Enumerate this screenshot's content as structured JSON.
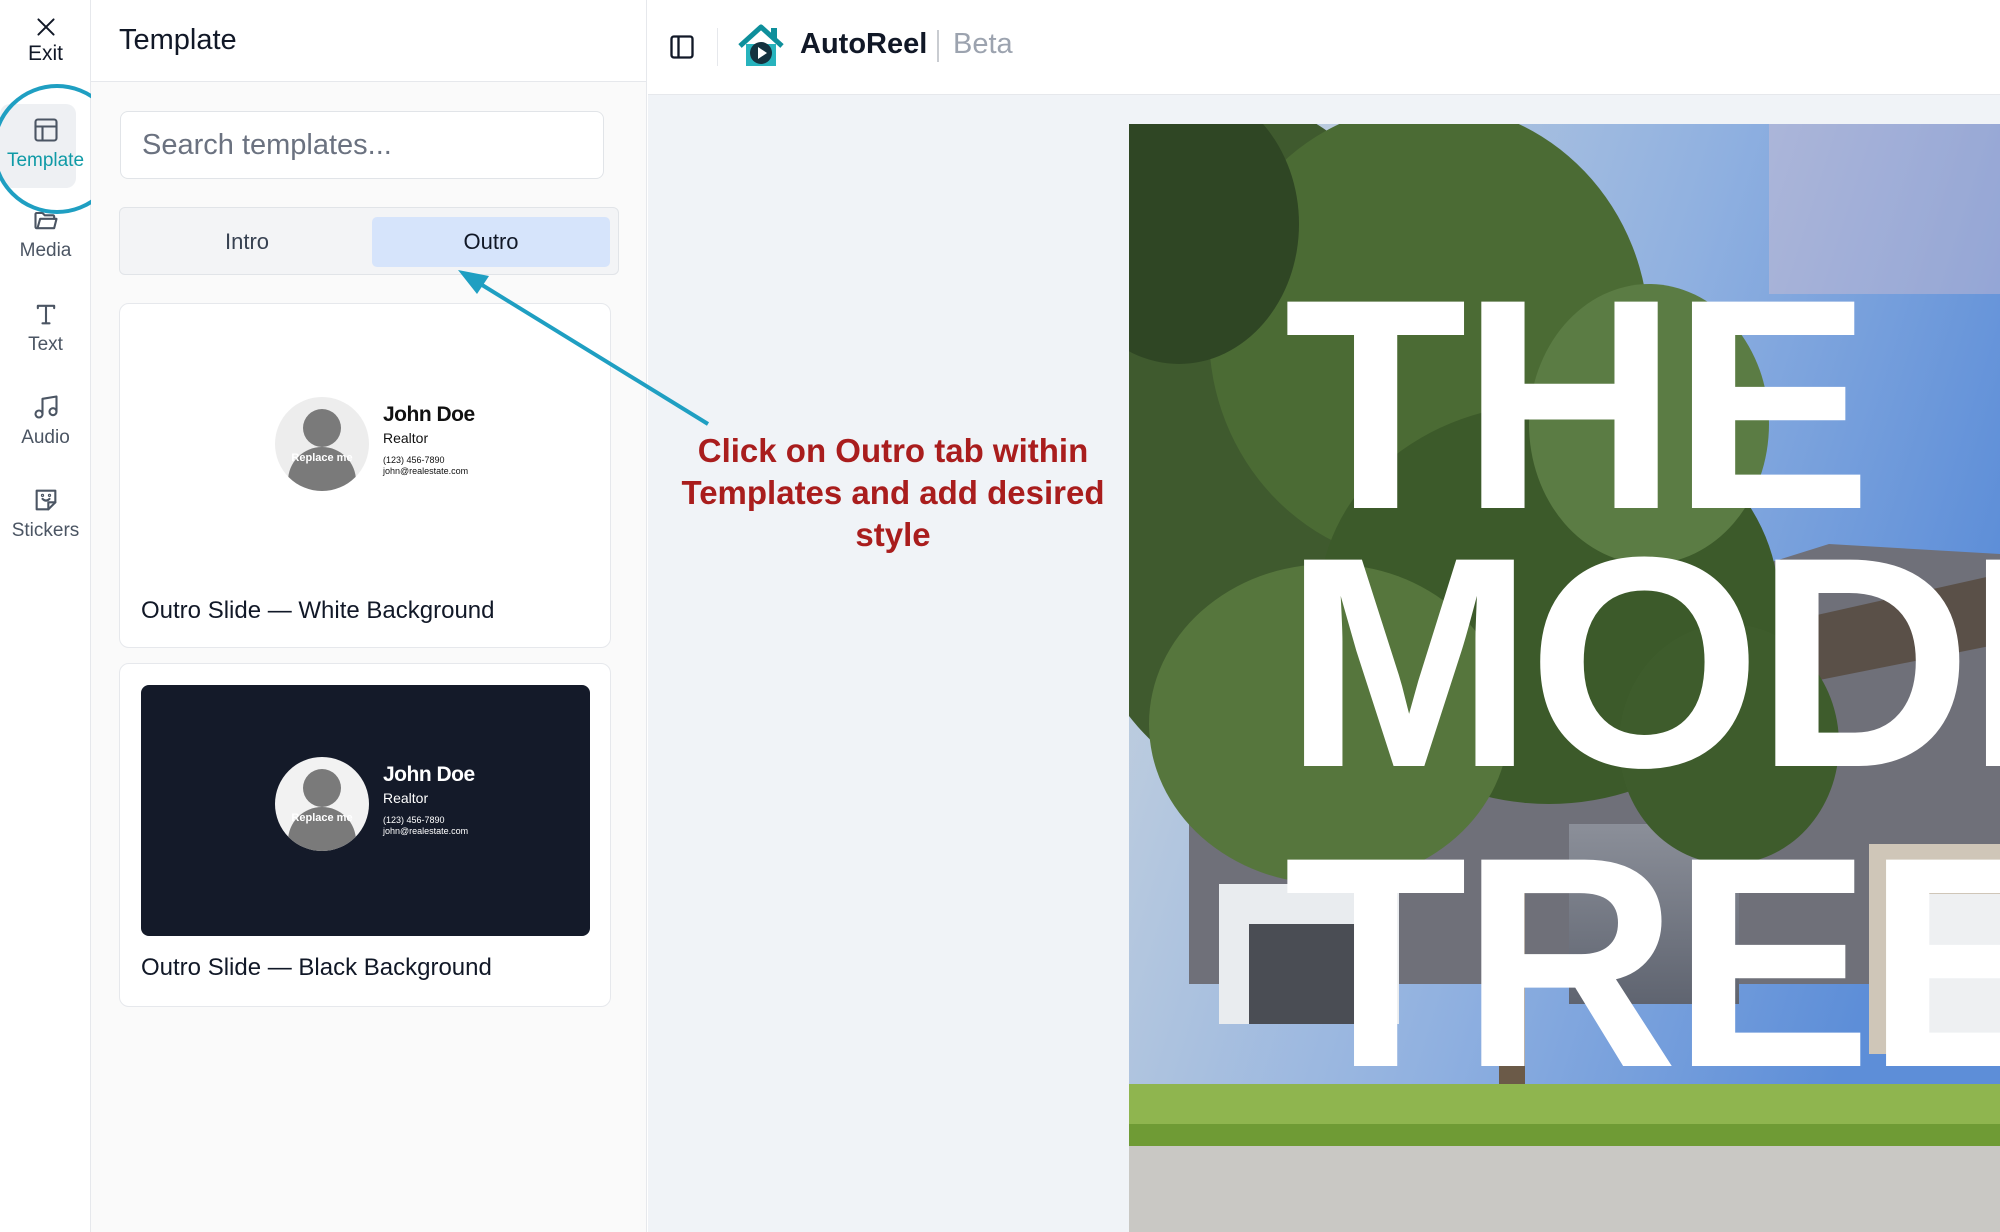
{
  "rail": {
    "exit_label": "Exit",
    "items": [
      {
        "label": "Template",
        "icon": "template-icon",
        "active": true
      },
      {
        "label": "Media",
        "icon": "folder-icon"
      },
      {
        "label": "Text",
        "icon": "text-icon"
      },
      {
        "label": "Audio",
        "icon": "music-icon"
      },
      {
        "label": "Stickers",
        "icon": "sticker-icon"
      }
    ]
  },
  "panel": {
    "title": "Template",
    "search_placeholder": "Search templates...",
    "tabs": [
      {
        "label": "Intro",
        "active": false
      },
      {
        "label": "Outro",
        "active": true
      }
    ],
    "cards": [
      {
        "name": "Outro Slide — White Background",
        "theme": "light",
        "person_name": "John Doe",
        "role": "Realtor",
        "phone": "(123) 456-7890",
        "email": "john@realestate.com",
        "avatar_text": "Replace me"
      },
      {
        "name": "Outro Slide — Black Background",
        "theme": "dark",
        "person_name": "John Doe",
        "role": "Realtor",
        "phone": "(123) 456-7890",
        "email": "john@realestate.com",
        "avatar_text": "Replace me"
      }
    ]
  },
  "topbar": {
    "brand": "AutoReel",
    "badge": "Beta"
  },
  "canvas": {
    "lines": [
      "THE",
      "MODE",
      "TREEH"
    ]
  },
  "annotation": {
    "text": "Click on Outro tab within Templates and add desired style"
  },
  "colors": {
    "accent": "#0f9aa6",
    "annotation_red": "#a91d1d",
    "annotation_arrow": "#1f9fc2",
    "tab_active_bg": "#d6e4fb",
    "dark_card_bg": "#141a29"
  }
}
